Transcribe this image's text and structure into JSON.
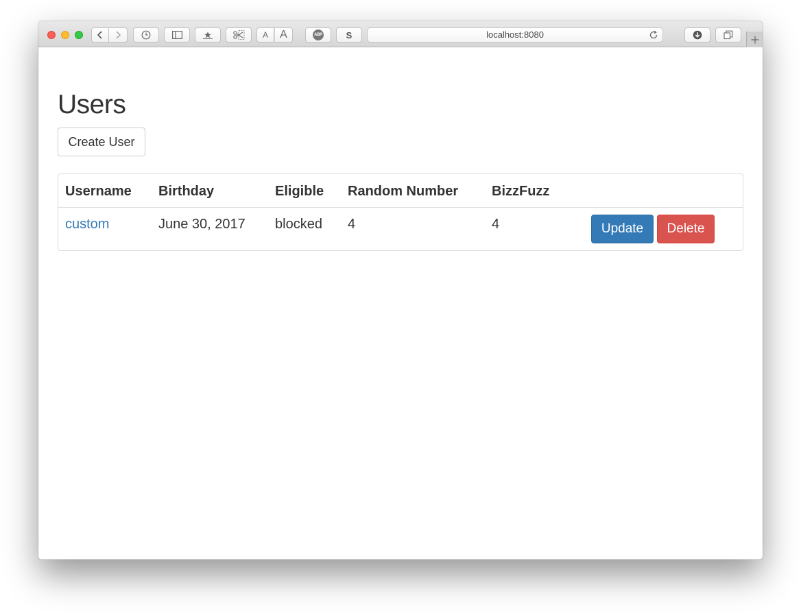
{
  "browser": {
    "url": "localhost:8080",
    "text_size_small": "A",
    "text_size_large": "A",
    "adblock_label": "ABP",
    "s_label": "S"
  },
  "page": {
    "title": "Users",
    "create_button": "Create User"
  },
  "table": {
    "headers": [
      "Username",
      "Birthday",
      "Eligible",
      "Random Number",
      "BizzFuzz"
    ],
    "rows": [
      {
        "username": "custom",
        "birthday": "June 30, 2017",
        "eligible": "blocked",
        "random_number": "4",
        "bizzfuzz": "4",
        "update_label": "Update",
        "delete_label": "Delete"
      }
    ]
  },
  "colors": {
    "link": "#337ab7",
    "primary": "#337ab7",
    "danger": "#d9534f"
  }
}
